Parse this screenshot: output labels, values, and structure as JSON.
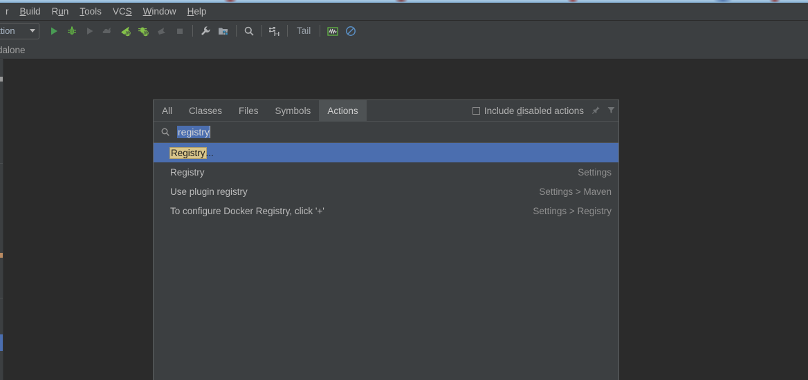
{
  "window": {
    "app_background_color": "#2b2b2b",
    "chrome_color": "#3c3f41",
    "accent_color": "#4b6eaf",
    "match_highlight_color": "#d8c58a"
  },
  "menu_bar": {
    "items": [
      {
        "label": "r",
        "mnemonic": "",
        "truncated": true
      },
      {
        "label": "Build",
        "mnemonic": "B"
      },
      {
        "label": "Run",
        "mnemonic": "u"
      },
      {
        "label": "Tools",
        "mnemonic": "T"
      },
      {
        "label": "VCS",
        "mnemonic": "S"
      },
      {
        "label": "Window",
        "mnemonic": "W"
      },
      {
        "label": "Help",
        "mnemonic": "H"
      }
    ]
  },
  "toolbar": {
    "run_config": {
      "label": "ttion",
      "icon": "chevron-down-icon"
    },
    "buttons": [
      {
        "name": "run-button",
        "icon": "play-icon"
      },
      {
        "name": "debug-button",
        "icon": "bug-icon"
      },
      {
        "name": "run-with-coverage-button",
        "icon": "play-muted-icon"
      },
      {
        "name": "profile-button",
        "icon": "cloud-muted-icon"
      },
      {
        "name": "run-jrebel-button",
        "icon": "rocket-jr-icon"
      },
      {
        "name": "debug-jrebel-button",
        "icon": "bug-jr-icon"
      },
      {
        "name": "attach-button",
        "icon": "arrow-muted-icon"
      },
      {
        "name": "stop-button",
        "icon": "stop-square-icon"
      },
      {
        "name": "settings-button",
        "icon": "wrench-icon"
      },
      {
        "name": "project-structure-button",
        "icon": "folder-modules-icon"
      },
      {
        "name": "search-everywhere-button",
        "icon": "search-icon"
      },
      {
        "name": "database-button",
        "icon": "database-save-icon"
      }
    ],
    "tail_label": "Tail",
    "right_buttons": [
      {
        "name": "monitor-button",
        "icon": "pulse-graph-icon",
        "color": "#62b543"
      },
      {
        "name": "suspend-button",
        "icon": "no-entry-icon",
        "color": "#5a8fc4"
      }
    ]
  },
  "breadcrumb": {
    "text": "dalone"
  },
  "search_everywhere": {
    "tabs": [
      {
        "label": "All",
        "selected": false
      },
      {
        "label": "Classes",
        "selected": false
      },
      {
        "label": "Files",
        "selected": false
      },
      {
        "label": "Symbols",
        "selected": false
      },
      {
        "label": "Actions",
        "selected": true
      }
    ],
    "include_disabled": {
      "label_before": "Include ",
      "mnemonic": "d",
      "label_after": "isabled actions",
      "checked": false
    },
    "toolbar_icons": [
      {
        "name": "pin-icon"
      },
      {
        "name": "filter-icon"
      }
    ],
    "search": {
      "icon": "search-icon",
      "value": "registry",
      "selected": true
    },
    "results": [
      {
        "match": "Registry",
        "rest": "...",
        "location": "",
        "selected": true
      },
      {
        "match": "",
        "rest": "Registry",
        "location": "Settings",
        "selected": false
      },
      {
        "match": "",
        "rest": "Use plugin registry",
        "location": "Settings > Maven",
        "selected": false
      },
      {
        "match": "",
        "rest": "To configure Docker Registry, click '+'",
        "location": "Settings > Registry",
        "selected": false
      }
    ]
  }
}
